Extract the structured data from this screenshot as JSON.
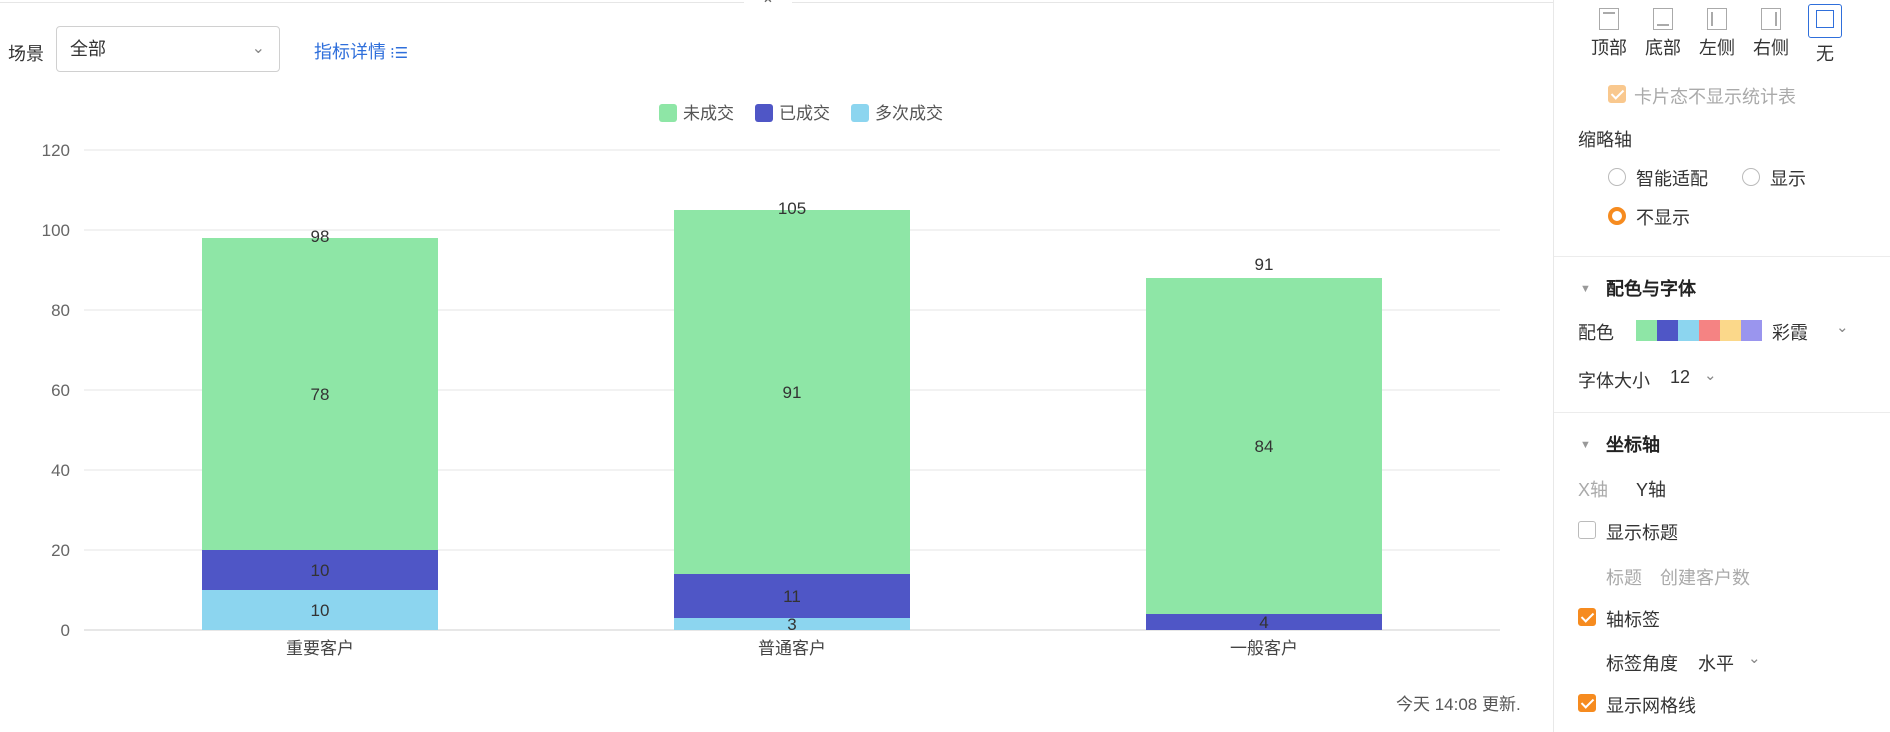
{
  "toolbar": {
    "scene_label": "场景",
    "scene_value": "全部",
    "detail_link": "指标详情"
  },
  "chart_data": {
    "type": "bar",
    "stacked": true,
    "categories": [
      "重要客户",
      "普通客户",
      "一般客户"
    ],
    "series": [
      {
        "name": "多次成交",
        "color": "#8cd5ef",
        "values": [
          10,
          3,
          0
        ]
      },
      {
        "name": "已成交",
        "color": "#4f56c6",
        "values": [
          10,
          11,
          4
        ]
      },
      {
        "name": "未成交",
        "color": "#8ee6a6",
        "values": [
          78,
          91,
          84
        ]
      }
    ],
    "series_label_values": [
      [
        "10",
        "3",
        ""
      ],
      [
        "10",
        "11",
        "4"
      ],
      [
        "78",
        "91",
        "84"
      ]
    ],
    "totals": [
      98,
      105,
      91
    ],
    "legend": [
      "未成交",
      "已成交",
      "多次成交"
    ],
    "legend_position": "top-center",
    "ylim": [
      0,
      120
    ],
    "yticks": [
      0,
      20,
      40,
      60,
      80,
      100,
      120
    ],
    "grid": true,
    "xlabel": "",
    "ylabel": ""
  },
  "footer": {
    "update_note": "今天 14:08 更新."
  },
  "settings": {
    "legend_positions": [
      {
        "label": "顶部",
        "icon": "legend-top-icon"
      },
      {
        "label": "底部",
        "icon": "legend-bottom-icon"
      },
      {
        "label": "左侧",
        "icon": "legend-left-icon"
      },
      {
        "label": "右侧",
        "icon": "legend-right-icon"
      },
      {
        "label": "无",
        "icon": "legend-none-icon",
        "selected": true
      }
    ],
    "card_no_stats_label": "卡片态不显示统计表",
    "thumbnail_axis": {
      "title": "缩略轴",
      "options": [
        "智能适配",
        "显示",
        "不显示"
      ],
      "selected": "不显示"
    },
    "color_font": {
      "title": "配色与字体",
      "palette_label": "配色",
      "palette_name": "彩霞",
      "palette_colors": [
        "#8ee6a6",
        "#4f56c6",
        "#8cd5ef",
        "#f58383",
        "#fbd88a",
        "#9a95ee"
      ],
      "font_size_label": "字体大小",
      "font_size_value": "12"
    },
    "axis": {
      "title": "坐标轴",
      "tab_x": "X轴",
      "tab_y": "Y轴",
      "show_title_label": "显示标题",
      "title_field_label": "标题",
      "title_field_value": "创建客户数",
      "axis_label": "轴标签",
      "label_angle_label": "标签角度",
      "label_angle_value": "水平",
      "show_grid_label": "显示网格线"
    },
    "accent_color": "#f68b1f"
  }
}
